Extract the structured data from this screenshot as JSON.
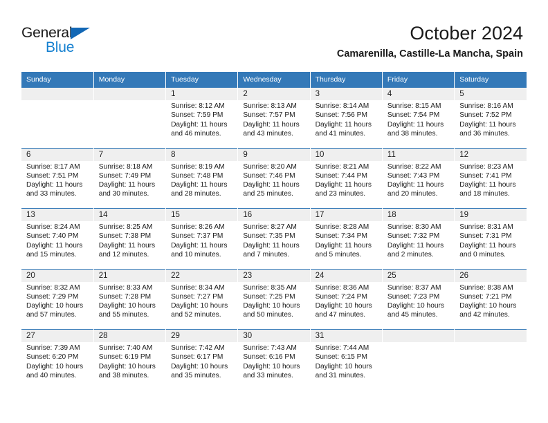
{
  "brand": {
    "name_part1": "General",
    "name_part2": "Blue",
    "triangle_color": "#1267b5",
    "blue_color": "#1580d0"
  },
  "header": {
    "title": "October 2024",
    "subtitle": "Camarenilla, Castille-La Mancha, Spain",
    "header_bg": "#3479b8",
    "daynum_bg": "#efefef"
  },
  "weekdays": [
    "Sunday",
    "Monday",
    "Tuesday",
    "Wednesday",
    "Thursday",
    "Friday",
    "Saturday"
  ],
  "labels": {
    "sunrise_prefix": "Sunrise:",
    "sunset_prefix": "Sunset:",
    "daylight_prefix": "Daylight:"
  },
  "weeks": [
    {
      "days": [
        {
          "num": "",
          "empty": true
        },
        {
          "num": "",
          "empty": true
        },
        {
          "num": "1",
          "sunrise": "Sunrise: 8:12 AM",
          "sunset": "Sunset: 7:59 PM",
          "daylight_l1": "Daylight: 11 hours",
          "daylight_l2": "and 46 minutes."
        },
        {
          "num": "2",
          "sunrise": "Sunrise: 8:13 AM",
          "sunset": "Sunset: 7:57 PM",
          "daylight_l1": "Daylight: 11 hours",
          "daylight_l2": "and 43 minutes."
        },
        {
          "num": "3",
          "sunrise": "Sunrise: 8:14 AM",
          "sunset": "Sunset: 7:56 PM",
          "daylight_l1": "Daylight: 11 hours",
          "daylight_l2": "and 41 minutes."
        },
        {
          "num": "4",
          "sunrise": "Sunrise: 8:15 AM",
          "sunset": "Sunset: 7:54 PM",
          "daylight_l1": "Daylight: 11 hours",
          "daylight_l2": "and 38 minutes."
        },
        {
          "num": "5",
          "sunrise": "Sunrise: 8:16 AM",
          "sunset": "Sunset: 7:52 PM",
          "daylight_l1": "Daylight: 11 hours",
          "daylight_l2": "and 36 minutes."
        }
      ]
    },
    {
      "days": [
        {
          "num": "6",
          "sunrise": "Sunrise: 8:17 AM",
          "sunset": "Sunset: 7:51 PM",
          "daylight_l1": "Daylight: 11 hours",
          "daylight_l2": "and 33 minutes."
        },
        {
          "num": "7",
          "sunrise": "Sunrise: 8:18 AM",
          "sunset": "Sunset: 7:49 PM",
          "daylight_l1": "Daylight: 11 hours",
          "daylight_l2": "and 30 minutes."
        },
        {
          "num": "8",
          "sunrise": "Sunrise: 8:19 AM",
          "sunset": "Sunset: 7:48 PM",
          "daylight_l1": "Daylight: 11 hours",
          "daylight_l2": "and 28 minutes."
        },
        {
          "num": "9",
          "sunrise": "Sunrise: 8:20 AM",
          "sunset": "Sunset: 7:46 PM",
          "daylight_l1": "Daylight: 11 hours",
          "daylight_l2": "and 25 minutes."
        },
        {
          "num": "10",
          "sunrise": "Sunrise: 8:21 AM",
          "sunset": "Sunset: 7:44 PM",
          "daylight_l1": "Daylight: 11 hours",
          "daylight_l2": "and 23 minutes."
        },
        {
          "num": "11",
          "sunrise": "Sunrise: 8:22 AM",
          "sunset": "Sunset: 7:43 PM",
          "daylight_l1": "Daylight: 11 hours",
          "daylight_l2": "and 20 minutes."
        },
        {
          "num": "12",
          "sunrise": "Sunrise: 8:23 AM",
          "sunset": "Sunset: 7:41 PM",
          "daylight_l1": "Daylight: 11 hours",
          "daylight_l2": "and 18 minutes."
        }
      ]
    },
    {
      "days": [
        {
          "num": "13",
          "sunrise": "Sunrise: 8:24 AM",
          "sunset": "Sunset: 7:40 PM",
          "daylight_l1": "Daylight: 11 hours",
          "daylight_l2": "and 15 minutes."
        },
        {
          "num": "14",
          "sunrise": "Sunrise: 8:25 AM",
          "sunset": "Sunset: 7:38 PM",
          "daylight_l1": "Daylight: 11 hours",
          "daylight_l2": "and 12 minutes."
        },
        {
          "num": "15",
          "sunrise": "Sunrise: 8:26 AM",
          "sunset": "Sunset: 7:37 PM",
          "daylight_l1": "Daylight: 11 hours",
          "daylight_l2": "and 10 minutes."
        },
        {
          "num": "16",
          "sunrise": "Sunrise: 8:27 AM",
          "sunset": "Sunset: 7:35 PM",
          "daylight_l1": "Daylight: 11 hours",
          "daylight_l2": "and 7 minutes."
        },
        {
          "num": "17",
          "sunrise": "Sunrise: 8:28 AM",
          "sunset": "Sunset: 7:34 PM",
          "daylight_l1": "Daylight: 11 hours",
          "daylight_l2": "and 5 minutes."
        },
        {
          "num": "18",
          "sunrise": "Sunrise: 8:30 AM",
          "sunset": "Sunset: 7:32 PM",
          "daylight_l1": "Daylight: 11 hours",
          "daylight_l2": "and 2 minutes."
        },
        {
          "num": "19",
          "sunrise": "Sunrise: 8:31 AM",
          "sunset": "Sunset: 7:31 PM",
          "daylight_l1": "Daylight: 11 hours",
          "daylight_l2": "and 0 minutes."
        }
      ]
    },
    {
      "days": [
        {
          "num": "20",
          "sunrise": "Sunrise: 8:32 AM",
          "sunset": "Sunset: 7:29 PM",
          "daylight_l1": "Daylight: 10 hours",
          "daylight_l2": "and 57 minutes."
        },
        {
          "num": "21",
          "sunrise": "Sunrise: 8:33 AM",
          "sunset": "Sunset: 7:28 PM",
          "daylight_l1": "Daylight: 10 hours",
          "daylight_l2": "and 55 minutes."
        },
        {
          "num": "22",
          "sunrise": "Sunrise: 8:34 AM",
          "sunset": "Sunset: 7:27 PM",
          "daylight_l1": "Daylight: 10 hours",
          "daylight_l2": "and 52 minutes."
        },
        {
          "num": "23",
          "sunrise": "Sunrise: 8:35 AM",
          "sunset": "Sunset: 7:25 PM",
          "daylight_l1": "Daylight: 10 hours",
          "daylight_l2": "and 50 minutes."
        },
        {
          "num": "24",
          "sunrise": "Sunrise: 8:36 AM",
          "sunset": "Sunset: 7:24 PM",
          "daylight_l1": "Daylight: 10 hours",
          "daylight_l2": "and 47 minutes."
        },
        {
          "num": "25",
          "sunrise": "Sunrise: 8:37 AM",
          "sunset": "Sunset: 7:23 PM",
          "daylight_l1": "Daylight: 10 hours",
          "daylight_l2": "and 45 minutes."
        },
        {
          "num": "26",
          "sunrise": "Sunrise: 8:38 AM",
          "sunset": "Sunset: 7:21 PM",
          "daylight_l1": "Daylight: 10 hours",
          "daylight_l2": "and 42 minutes."
        }
      ]
    },
    {
      "days": [
        {
          "num": "27",
          "sunrise": "Sunrise: 7:39 AM",
          "sunset": "Sunset: 6:20 PM",
          "daylight_l1": "Daylight: 10 hours",
          "daylight_l2": "and 40 minutes."
        },
        {
          "num": "28",
          "sunrise": "Sunrise: 7:40 AM",
          "sunset": "Sunset: 6:19 PM",
          "daylight_l1": "Daylight: 10 hours",
          "daylight_l2": "and 38 minutes."
        },
        {
          "num": "29",
          "sunrise": "Sunrise: 7:42 AM",
          "sunset": "Sunset: 6:17 PM",
          "daylight_l1": "Daylight: 10 hours",
          "daylight_l2": "and 35 minutes."
        },
        {
          "num": "30",
          "sunrise": "Sunrise: 7:43 AM",
          "sunset": "Sunset: 6:16 PM",
          "daylight_l1": "Daylight: 10 hours",
          "daylight_l2": "and 33 minutes."
        },
        {
          "num": "31",
          "sunrise": "Sunrise: 7:44 AM",
          "sunset": "Sunset: 6:15 PM",
          "daylight_l1": "Daylight: 10 hours",
          "daylight_l2": "and 31 minutes."
        },
        {
          "num": "",
          "empty": true
        },
        {
          "num": "",
          "empty": true
        }
      ]
    }
  ]
}
